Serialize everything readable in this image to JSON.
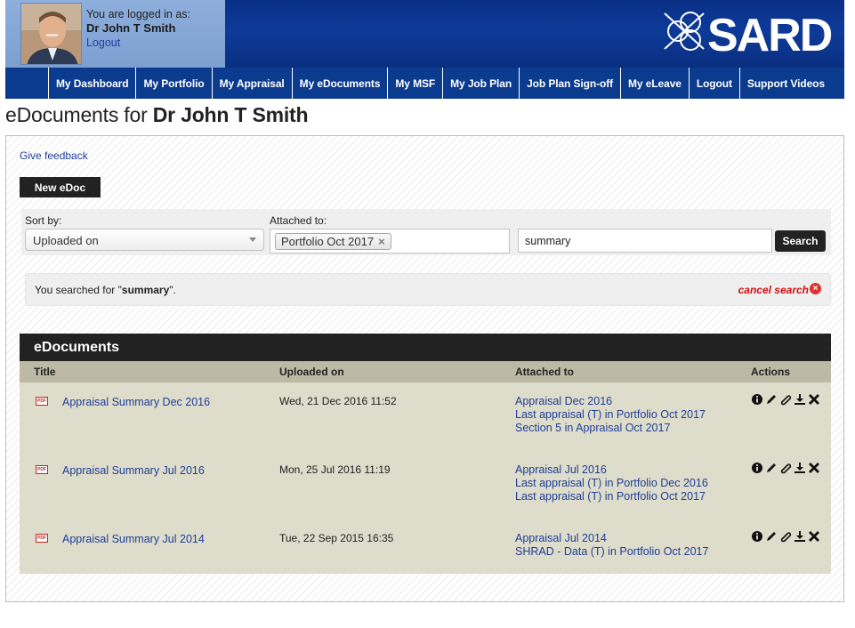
{
  "header": {
    "logged_in_label": "You are logged in as:",
    "user_name": "Dr John T Smith",
    "logout_link": "Logout",
    "logo_text": "SARD"
  },
  "nav": [
    {
      "label": "My Dashboard"
    },
    {
      "label": "My Portfolio"
    },
    {
      "label": "My Appraisal"
    },
    {
      "label": "My eDocuments"
    },
    {
      "label": "My MSF"
    },
    {
      "label": "My Job Plan"
    },
    {
      "label": "Job Plan Sign-off"
    },
    {
      "label": "My eLeave"
    },
    {
      "label": "Logout"
    },
    {
      "label": "Support Videos"
    }
  ],
  "page": {
    "title_prefix": "eDocuments for ",
    "title_name": "Dr John T Smith",
    "feedback_link": "Give feedback",
    "new_edoc_label": "New eDoc"
  },
  "filters": {
    "sort_label": "Sort by:",
    "sort_value": "Uploaded on",
    "attached_label": "Attached to:",
    "attached_tag": "Portfolio Oct 2017",
    "search_value": "summary",
    "search_button": "Search"
  },
  "notice": {
    "prefix": "You searched for \"",
    "term": "summary",
    "suffix": "\".",
    "cancel_label": "cancel search"
  },
  "table": {
    "title": "eDocuments",
    "columns": [
      "Title",
      "Uploaded on",
      "Attached to",
      "Actions"
    ],
    "rows": [
      {
        "title": "Appraisal Summary Dec 2016",
        "uploaded": "Wed, 21 Dec 2016 11:52",
        "attached": [
          "Appraisal Dec 2016",
          "Last appraisal (T) in Portfolio Oct 2017",
          "Section 5 in Appraisal Oct 2017"
        ]
      },
      {
        "title": "Appraisal Summary Jul 2016",
        "uploaded": "Mon, 25 Jul 2016 11:19",
        "attached": [
          "Appraisal Jul 2016",
          "Last appraisal (T) in Portfolio Dec 2016",
          "Last appraisal (T) in Portfolio Oct 2017"
        ]
      },
      {
        "title": "Appraisal Summary Jul 2014",
        "uploaded": "Tue, 22 Sep 2015 16:35",
        "attached": [
          "Appraisal Jul 2014",
          "SHRAD - Data (T) in Portfolio Oct 2017"
        ]
      }
    ],
    "action_icons": [
      "info-icon",
      "edit-pencil-icon",
      "attach-paperclip-icon",
      "download-icon",
      "delete-x-icon"
    ]
  }
}
